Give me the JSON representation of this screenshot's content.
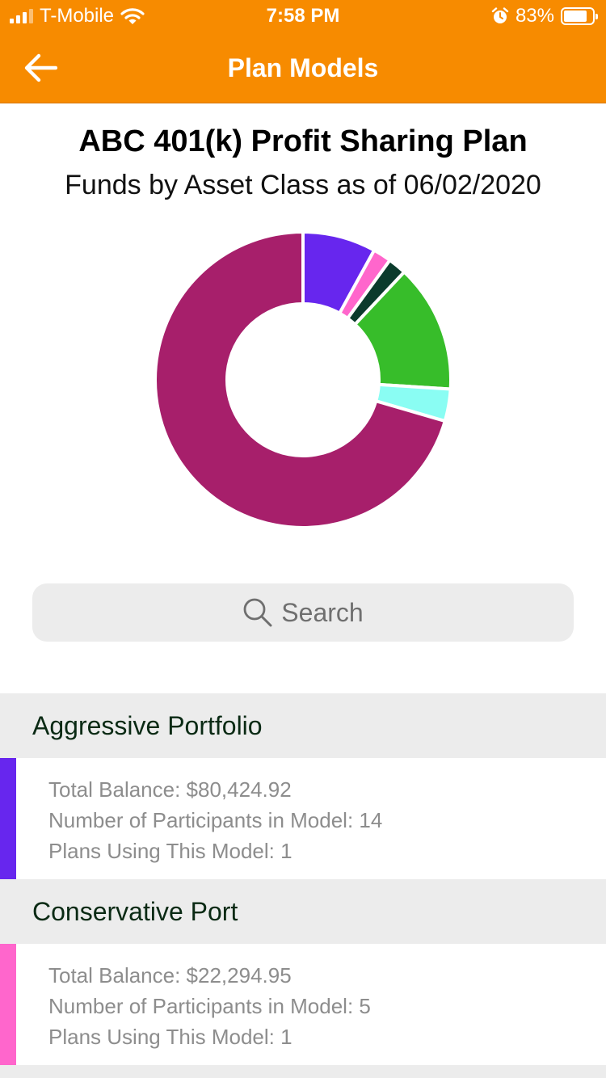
{
  "status_bar": {
    "carrier": "T-Mobile",
    "time": "7:58 PM",
    "battery": "83%",
    "battery_level": 0.83,
    "icons": [
      "signal-icon",
      "wifi-icon",
      "alarm-icon",
      "battery-icon"
    ]
  },
  "nav": {
    "title": "Plan Models",
    "back_icon": "back-arrow-icon"
  },
  "header": {
    "plan_name": "ABC 401(k) Profit Sharing Plan",
    "subtitle": "Funds by Asset Class as of 06/02/2020"
  },
  "chart_data": {
    "type": "pie",
    "slices": [
      {
        "value": 8.0,
        "color": "#6726ee"
      },
      {
        "value": 2.0,
        "color": "#ff66cc"
      },
      {
        "value": 2.0,
        "color": "#0b3b2c"
      },
      {
        "value": 14.0,
        "color": "#37bd2a"
      },
      {
        "value": 3.5,
        "color": "#8afdf3"
      },
      {
        "value": 70.5,
        "color": "#a71f6b"
      }
    ]
  },
  "search": {
    "placeholder": "Search",
    "icon": "search-icon"
  },
  "models": [
    {
      "name": "Aggressive Portfolio",
      "color": "#6726ee",
      "total_balance": "Total Balance: $80,424.92",
      "participants": "Number of Participants in Model: 14",
      "plans": "Plans Using This Model: 1"
    },
    {
      "name": "Conservative Port",
      "color": "#ff66cc",
      "total_balance": "Total Balance: $22,294.95",
      "participants": "Number of Participants in Model: 5",
      "plans": "Plans Using This Model: 1"
    }
  ],
  "colors": {
    "accent": "#f78b00",
    "list_header_bg": "#ececec"
  }
}
